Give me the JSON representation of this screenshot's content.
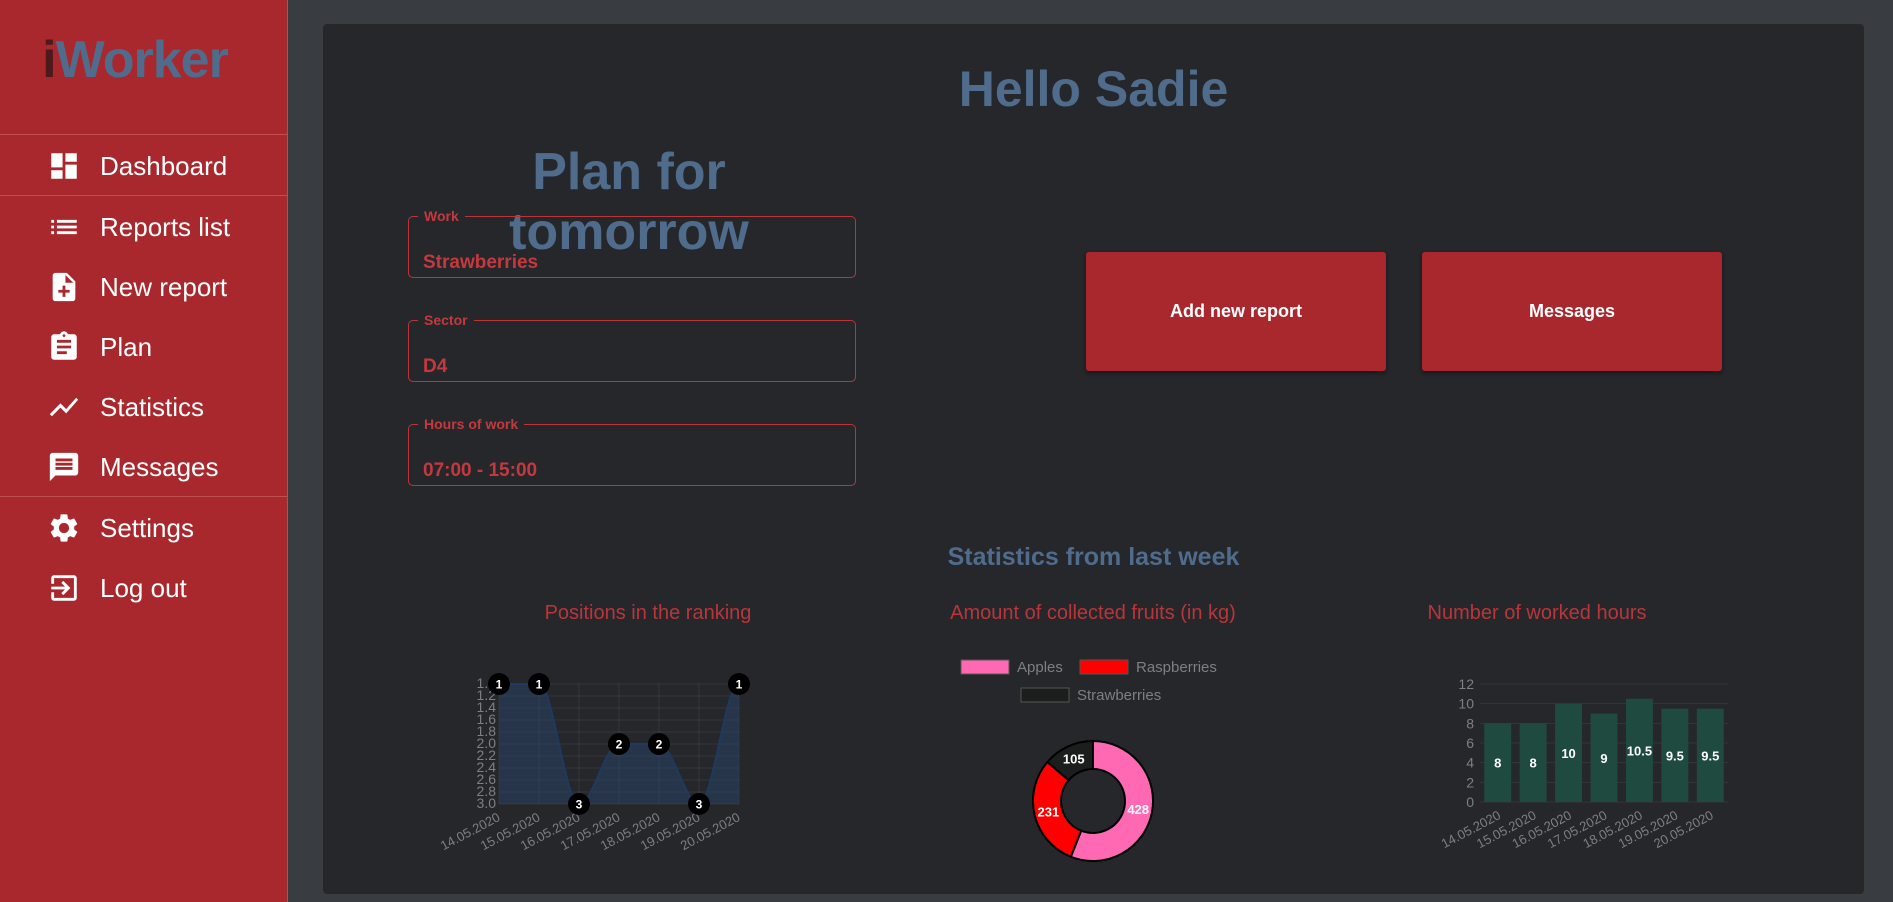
{
  "app": {
    "logo_lead": "i",
    "logo_rest": "Worker"
  },
  "sidebar": {
    "items": [
      {
        "label": "Dashboard",
        "icon": "dashboard-icon"
      },
      {
        "label": "Reports list",
        "icon": "list-icon"
      },
      {
        "label": "New report",
        "icon": "note-add-icon"
      },
      {
        "label": "Plan",
        "icon": "clipboard-icon"
      },
      {
        "label": "Statistics",
        "icon": "trending-icon"
      },
      {
        "label": "Messages",
        "icon": "message-icon"
      },
      {
        "label": "Settings",
        "icon": "gear-icon"
      },
      {
        "label": "Log out",
        "icon": "logout-icon"
      }
    ]
  },
  "main": {
    "greeting": "Hello Sadie",
    "plan": {
      "title": "Plan for tomorrow",
      "fields": [
        {
          "label": "Work",
          "value": "Strawberries"
        },
        {
          "label": "Sector",
          "value": "D4"
        },
        {
          "label": "Hours of work",
          "value": "07:00 - 15:00"
        }
      ]
    },
    "buttons": {
      "add_report": "Add new report",
      "messages": "Messages"
    },
    "stats_title": "Statistics from last week"
  },
  "colors": {
    "sidebar_bg": "#a8282d",
    "accent_blue": "#4f6c8d",
    "accent_red": "#b8363a",
    "panel_bg": "#25272b",
    "page_bg": "#393c40"
  },
  "chart_data": [
    {
      "type": "line",
      "title": "Positions in the ranking",
      "x": [
        "14.05.2020",
        "15.05.2020",
        "16.05.2020",
        "17.05.2020",
        "18.05.2020",
        "19.05.2020",
        "20.05.2020"
      ],
      "series": [
        {
          "values": [
            1,
            1,
            3,
            2,
            2,
            3,
            1
          ]
        }
      ],
      "y_ticks": [
        "1.0",
        "1.2",
        "1.4",
        "1.6",
        "1.8",
        "2.0",
        "2.2",
        "2.4",
        "2.6",
        "2.8",
        "3.0"
      ],
      "ylim": [
        1,
        3
      ],
      "y_reversed": true,
      "grid": true,
      "fill": true,
      "color": "#1e3a5f"
    },
    {
      "type": "pie",
      "title": "Amount of collected fruits (in kg)",
      "donut": true,
      "legend_position": "top",
      "slices": [
        {
          "label": "Apples",
          "value": 428,
          "color": "#ff69b4"
        },
        {
          "label": "Raspberries",
          "value": 231,
          "color": "#ff0000"
        },
        {
          "label": "Strawberries",
          "value": 105,
          "color": "#1c1e1d"
        }
      ]
    },
    {
      "type": "bar",
      "title": "Number of worked hours",
      "categories": [
        "14.05.2020",
        "15.05.2020",
        "16.05.2020",
        "17.05.2020",
        "18.05.2020",
        "19.05.2020",
        "20.05.2020"
      ],
      "values": [
        8,
        8,
        10,
        9,
        10.5,
        9.5,
        9.5
      ],
      "labels": [
        "8",
        "8",
        "10",
        "9",
        "10.5",
        "9.5",
        "9.5"
      ],
      "y_ticks": [
        "0",
        "2",
        "4",
        "6",
        "8",
        "10",
        "12"
      ],
      "ylim": [
        0,
        12
      ],
      "grid": true,
      "color": "#1f4a40"
    }
  ]
}
